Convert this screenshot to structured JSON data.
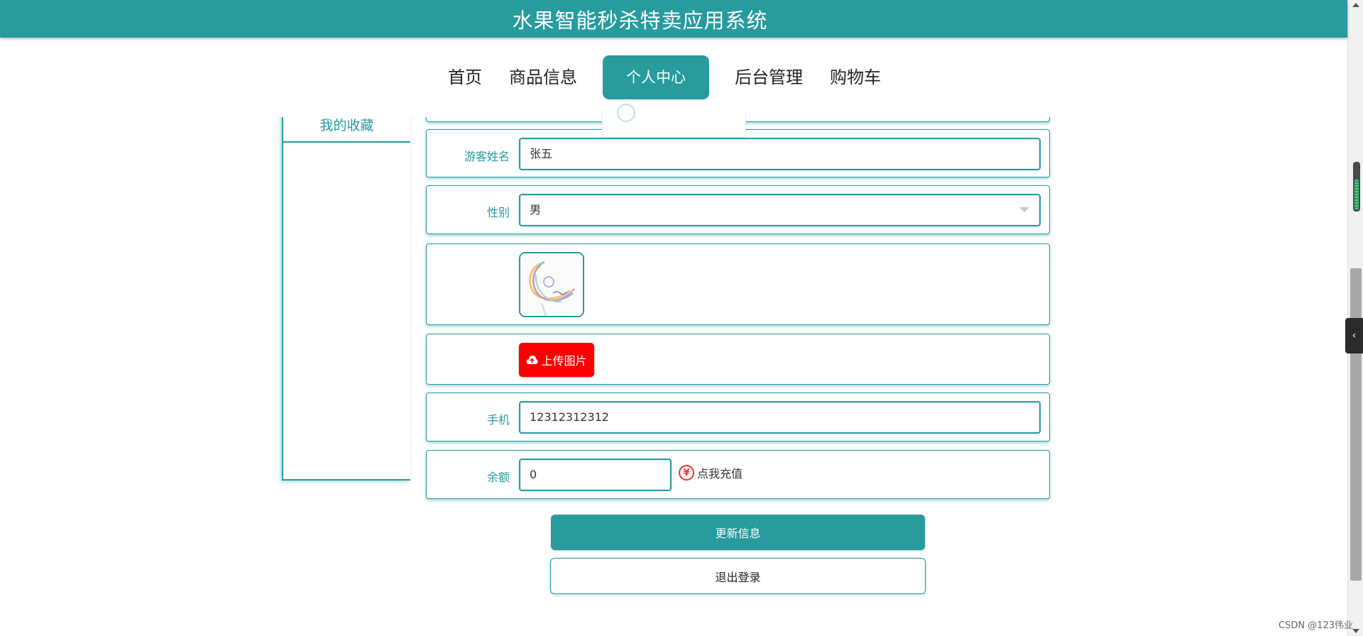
{
  "header": {
    "title": "水果智能秒杀特卖应用系统"
  },
  "nav": {
    "items": [
      {
        "label": "首页"
      },
      {
        "label": "商品信息"
      },
      {
        "label": "个人中心",
        "active": true
      },
      {
        "label": "后台管理"
      },
      {
        "label": "购物车"
      }
    ]
  },
  "sidebar": {
    "items": [
      {
        "label": "我的收藏"
      }
    ]
  },
  "form": {
    "visitor_name": {
      "label": "游客姓名",
      "value": "张五"
    },
    "gender": {
      "label": "性别",
      "value": "男"
    },
    "upload": {
      "label": "上传图片",
      "icon": "cloud-upload-icon"
    },
    "phone": {
      "label": "手机",
      "value": "12312312312"
    },
    "balance": {
      "label": "余额",
      "value": "0",
      "recharge_label": "点我充值",
      "recharge_icon": "yen-icon"
    }
  },
  "actions": {
    "update_label": "更新信息",
    "logout_label": "退出登录"
  },
  "sidebar_tab_icon": "chevron-left-icon",
  "watermark": "CSDN @123伟业",
  "colors": {
    "accent": "#279b9e",
    "upload": "#fb0000"
  }
}
